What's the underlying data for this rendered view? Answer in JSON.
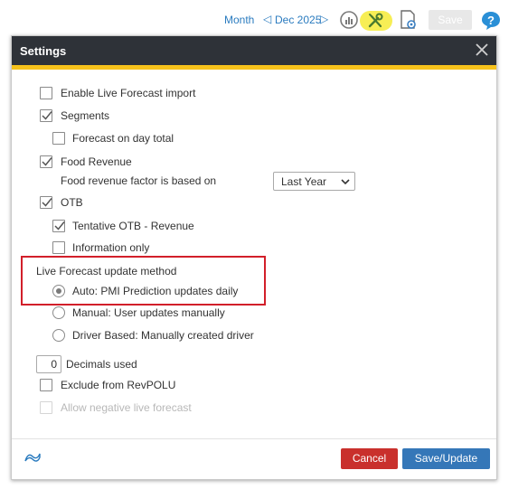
{
  "toolbar": {
    "view_label": "Month",
    "prev_icon": "chevron-left-icon",
    "period_label": "Dec 2025",
    "next_icon": "chevron-right-icon",
    "chart_icon": "gauge-chart-icon",
    "tools_icon": "tools-icon",
    "tools_highlight_color": "#f7ee55",
    "settings_icon": "page-settings-icon",
    "save_label": "Save",
    "help_icon": "help-icon"
  },
  "dialog": {
    "title": "Settings",
    "close_icon": "close-icon",
    "accent_color": "#f6c21b",
    "options": {
      "enable_live_import": {
        "label": "Enable Live Forecast import",
        "checked": false
      },
      "segments": {
        "label": "Segments",
        "checked": true
      },
      "forecast_day_total": {
        "label": "Forecast on day total",
        "checked": false
      },
      "food_revenue": {
        "label": "Food Revenue",
        "checked": true
      },
      "food_factor_label": "Food revenue factor is based on",
      "food_factor_value": "Last Year",
      "otb": {
        "label": "OTB",
        "checked": true
      },
      "tentative_otb": {
        "label": "Tentative OTB - Revenue",
        "checked": true
      },
      "information_only": {
        "label": "Information only",
        "checked": false
      }
    },
    "update_method": {
      "heading": "Live Forecast update method",
      "selected": "auto",
      "choices": [
        {
          "id": "auto",
          "label": "Auto: PMI Prediction updates daily"
        },
        {
          "id": "manual",
          "label": "Manual: User updates manually"
        },
        {
          "id": "driver",
          "label": "Driver Based: Manually created driver"
        }
      ],
      "highlight_color": "#d21f2a"
    },
    "decimals": {
      "value": "0",
      "label": "Decimals used"
    },
    "exclude_revpolu": {
      "label": "Exclude from RevPOLU",
      "checked": false
    },
    "allow_negative": {
      "label": "Allow negative live forecast",
      "checked": false,
      "disabled": true
    },
    "footer": {
      "flag_icon": "flag-icon",
      "cancel_label": "Cancel",
      "cancel_color": "#c9302c",
      "save_update_label": "Save/Update",
      "save_update_color": "#3577b8"
    }
  }
}
